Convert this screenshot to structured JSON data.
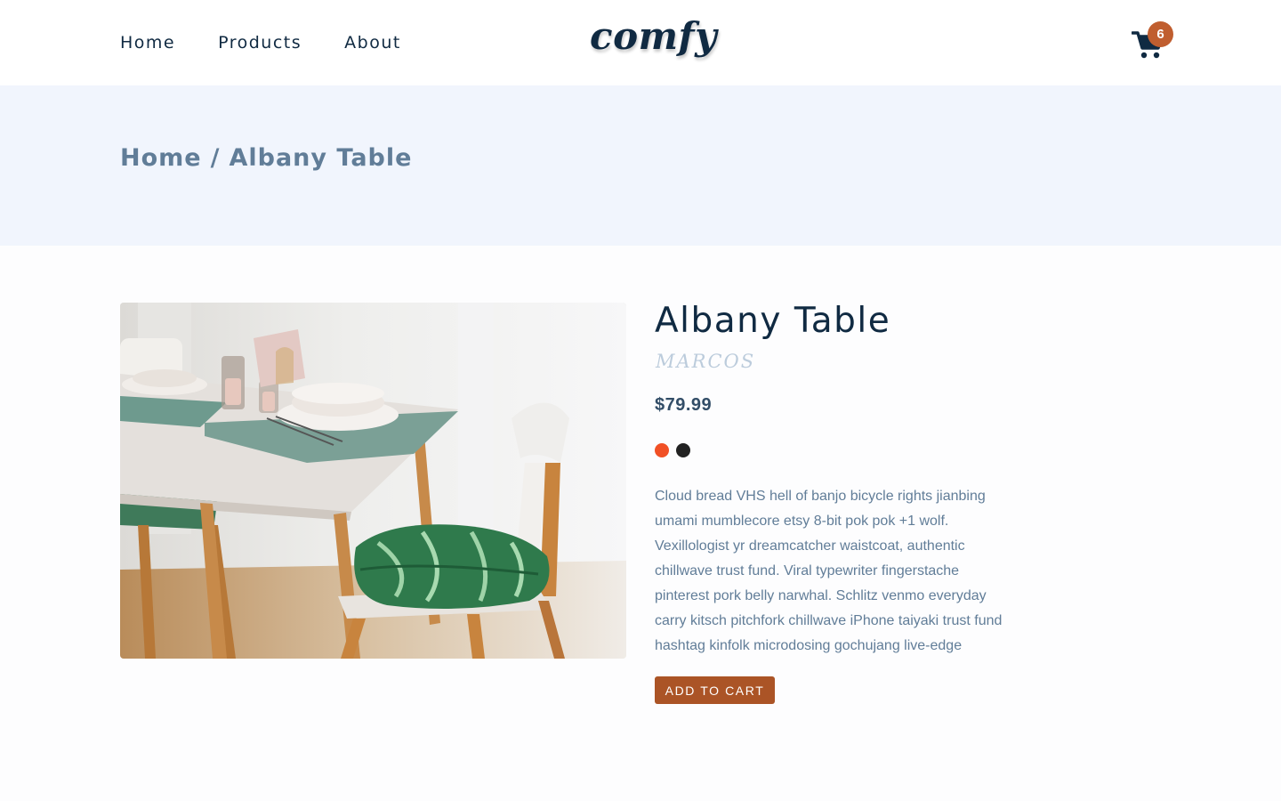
{
  "nav": {
    "links": [
      "Home",
      "Products",
      "About"
    ],
    "logo": "comfy",
    "cart_icon": "cart-icon",
    "cart_count": "6"
  },
  "hero": {
    "breadcrumb_home": "Home",
    "breadcrumb_separator": "/",
    "breadcrumb_current": "Albany Table"
  },
  "product": {
    "title": "Albany Table",
    "company": "marcos",
    "price": "$79.99",
    "colors": [
      "#f15025",
      "#222222"
    ],
    "description": "Cloud bread VHS hell of banjo bicycle rights jianbing umami mumblecore etsy 8-bit pok pok +1 wolf. Vexillologist yr dreamcatcher waistcoat, authentic chillwave trust fund. Viral typewriter fingerstache pinterest pork belly narwhal. Schlitz venmo everyday carry kitsch pitchfork chillwave iPhone taiyaki trust fund hashtag kinfolk microdosing gochujang live-edge",
    "add_to_cart": "add to cart",
    "image_icon": "dining-table-photo"
  },
  "colors": {
    "primary_text": "#102a42",
    "accent": "#ab5426",
    "hero_bg": "#f1f5fd",
    "muted": "#617d98"
  }
}
